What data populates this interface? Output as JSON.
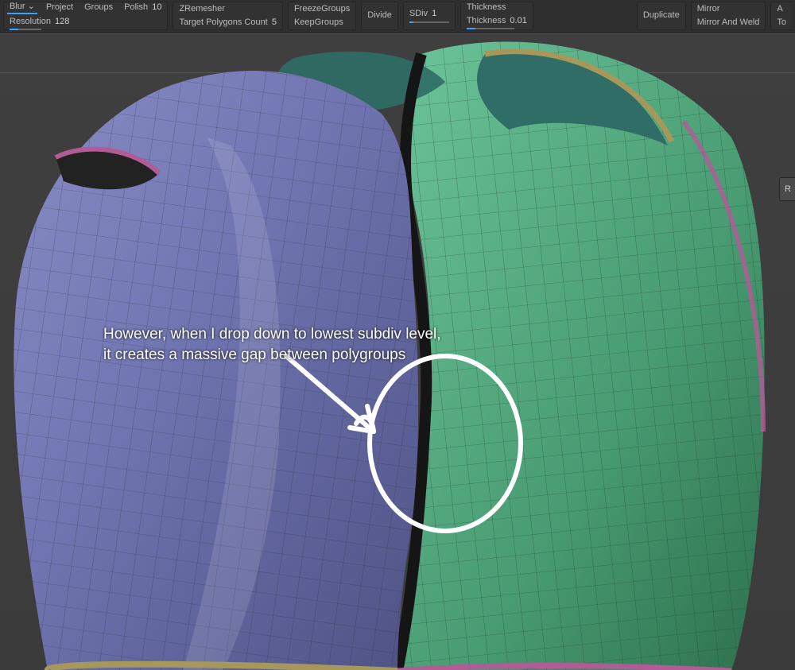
{
  "toolbar": {
    "blur": {
      "label": "Blur",
      "icon_suffix": "⌄"
    },
    "project": "Project",
    "groups": "Groups",
    "polish": {
      "label": "Polish",
      "value": "10"
    },
    "resolution": {
      "label": "Resolution",
      "value": "128"
    },
    "zremesher": "ZRemesher",
    "freeze_groups": "FreezeGroups",
    "keep_groups": "KeepGroups",
    "target_poly": {
      "label": "Target Polygons Count",
      "value": "5"
    },
    "divide": "Divide",
    "sdiv": {
      "label": "SDiv",
      "value": "1"
    },
    "thickness_label": "Thickness",
    "thickness": {
      "label": "Thickness",
      "value": "0.01"
    },
    "duplicate": "Duplicate",
    "mirror": "Mirror",
    "mirror_weld": "Mirror And Weld",
    "right_cut1": "A",
    "right_cut2": "To"
  },
  "right_button": "R",
  "annotation": {
    "line1": "However, when I drop down to lowest subdiv level,",
    "line2": "it creates a massive gap between polygroups"
  },
  "colors": {
    "front_polygroup": "#6a6ea5",
    "back_polygroup": "#4a9d74",
    "trim_olive": "#a6985a",
    "trim_pink": "#b15b97",
    "teal_inner": "#3f8d86"
  }
}
